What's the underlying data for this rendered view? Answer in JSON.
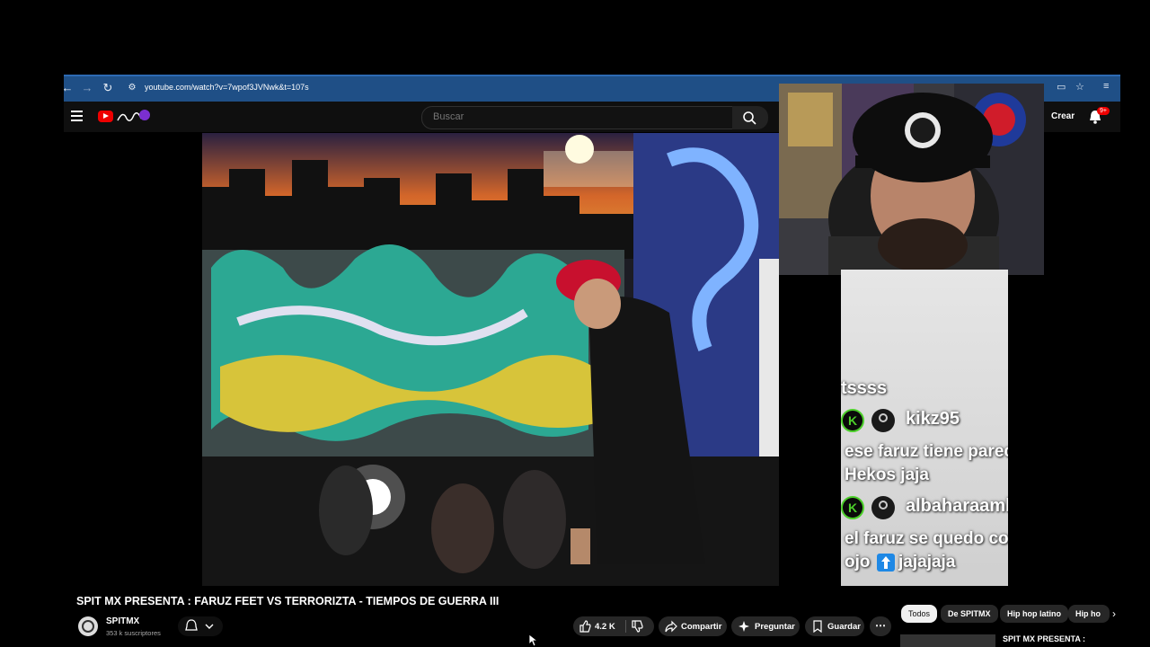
{
  "browser": {
    "url": "youtube.com/watch?v=7wpof3JVNwk&t=107s",
    "icons": [
      "back-arrow-icon",
      "forward-arrow-icon",
      "reload-icon",
      "site-info-icon",
      "install-icon",
      "star-icon",
      "reading-list-icon"
    ]
  },
  "header": {
    "search_placeholder": "Buscar",
    "create_label": "Crear",
    "notifications_badge": "9+"
  },
  "stream": {
    "chat": [
      {
        "type": "message",
        "text": "tssss"
      },
      {
        "type": "user",
        "name": "kikz95"
      },
      {
        "type": "message",
        "text": "ese faruz tiene parecido al"
      },
      {
        "type": "message",
        "text": "Hekos jaja"
      },
      {
        "type": "user",
        "name": "albaharaambar"
      },
      {
        "type": "message",
        "text": "el faruz se quedo con el buen"
      },
      {
        "type": "message_prefix",
        "text": "ojo"
      },
      {
        "type": "message_suffix",
        "text": "jajajaja"
      }
    ]
  },
  "video": {
    "title": "SPIT MX PRESENTA : FARUZ FEET VS TERRORIZTA - TIEMPOS DE GUERRA III",
    "channel_name": "SPITMX",
    "subscribers": "353 k suscriptores",
    "likes": "4.2 K",
    "share_label": "Compartir",
    "ask_label": "Preguntar",
    "save_label": "Guardar"
  },
  "chips": {
    "items": [
      "Todos",
      "De SPITMX",
      "Hip hop latino",
      "Hip ho"
    ]
  },
  "recommendation": {
    "title": "SPIT MX PRESENTA :"
  },
  "colors": {
    "chrome_bar": "#1f4f86",
    "yt_red": "#e00000",
    "page_bg": "#000000",
    "chat_green": "#4ccf2a"
  }
}
